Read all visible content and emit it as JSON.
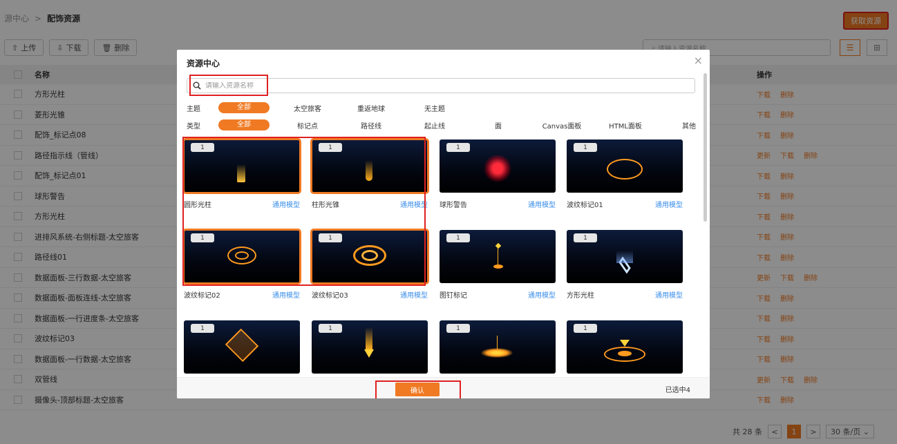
{
  "header": {
    "breadcrumb_root": "源中心",
    "breadcrumb_sep": ">",
    "breadcrumb_current": "配饰资源",
    "get_resource_label": "获取资源"
  },
  "toolbar": {
    "upload_label": "上传",
    "download_label": "下载",
    "delete_label": "删除",
    "search_placeholder": "请输入资源名称"
  },
  "table": {
    "col_name": "名称",
    "col_ops": "操作",
    "rows": [
      {
        "name": "方形光柱",
        "ops": [
          "下载",
          "删除"
        ]
      },
      {
        "name": "菱形光锥",
        "ops": [
          "下载",
          "删除"
        ]
      },
      {
        "name": "配饰_标记点08",
        "ops": [
          "下载",
          "删除"
        ]
      },
      {
        "name": "路径指示线（管线）",
        "ops": [
          "更新",
          "下载",
          "删除"
        ]
      },
      {
        "name": "配饰_标记点01",
        "ops": [
          "下载",
          "删除"
        ]
      },
      {
        "name": "球形警告",
        "ops": [
          "下载",
          "删除"
        ]
      },
      {
        "name": "方形光柱",
        "ops": [
          "下载",
          "删除"
        ]
      },
      {
        "name": "进排风系统-右侧标题-太空旅客",
        "ops": [
          "下载",
          "删除"
        ]
      },
      {
        "name": "路径线01",
        "ops": [
          "下载",
          "删除"
        ]
      },
      {
        "name": "数据面板-三行数据-太空旅客",
        "ops": [
          "更新",
          "下载",
          "删除"
        ]
      },
      {
        "name": "数据面板-面板连线-太空旅客",
        "ops": [
          "下载",
          "删除"
        ]
      },
      {
        "name": "数据面板-一行进度条-太空旅客",
        "ops": [
          "下载",
          "删除"
        ]
      },
      {
        "name": "波纹标记03",
        "ops": [
          "下载",
          "删除"
        ]
      },
      {
        "name": "数据面板-一行数据-太空旅客",
        "ops": [
          "下载",
          "删除"
        ]
      },
      {
        "name": "双管线",
        "ops": [
          "更新",
          "下载",
          "删除"
        ]
      },
      {
        "name": "摄像头-顶部标题-太空旅客",
        "ops": [
          "下载",
          "删除"
        ]
      }
    ]
  },
  "pager": {
    "total": "共 28 条",
    "prev": "<",
    "current": "1",
    "next": ">",
    "page_size": "30 条/页"
  },
  "modal": {
    "title": "资源中心",
    "close": "×",
    "search_placeholder": "请输入资源名称",
    "theme_label": "主题",
    "themes": [
      "全部",
      "太空旅客",
      "重返地球",
      "无主题"
    ],
    "type_label": "类型",
    "types": [
      "全部",
      "标记点",
      "路径线",
      "起止线",
      "面",
      "Canvas面板",
      "HTML面板",
      "其他"
    ],
    "cards": [
      {
        "name": "圆形光柱",
        "type": "通用模型",
        "count": "1"
      },
      {
        "name": "柱形光锥",
        "type": "通用模型",
        "count": "1"
      },
      {
        "name": "球形警告",
        "type": "通用模型",
        "count": "1"
      },
      {
        "name": "波纹标记01",
        "type": "通用模型",
        "count": "1"
      },
      {
        "name": "波纹标记02",
        "type": "通用模型",
        "count": "1"
      },
      {
        "name": "波纹标记03",
        "type": "通用模型",
        "count": "1"
      },
      {
        "name": "图钉标记",
        "type": "通用模型",
        "count": "1"
      },
      {
        "name": "方形光柱",
        "type": "通用模型",
        "count": "1"
      },
      {
        "name": "",
        "type": "",
        "count": "1"
      },
      {
        "name": "",
        "type": "",
        "count": "1"
      },
      {
        "name": "",
        "type": "",
        "count": "1"
      },
      {
        "name": "",
        "type": "",
        "count": "1"
      }
    ],
    "confirm_label": "确认",
    "selected_text": "已选中4"
  },
  "colors": {
    "accent": "#f07a23",
    "link": "#3b8eea",
    "highlight": "#e02020"
  }
}
